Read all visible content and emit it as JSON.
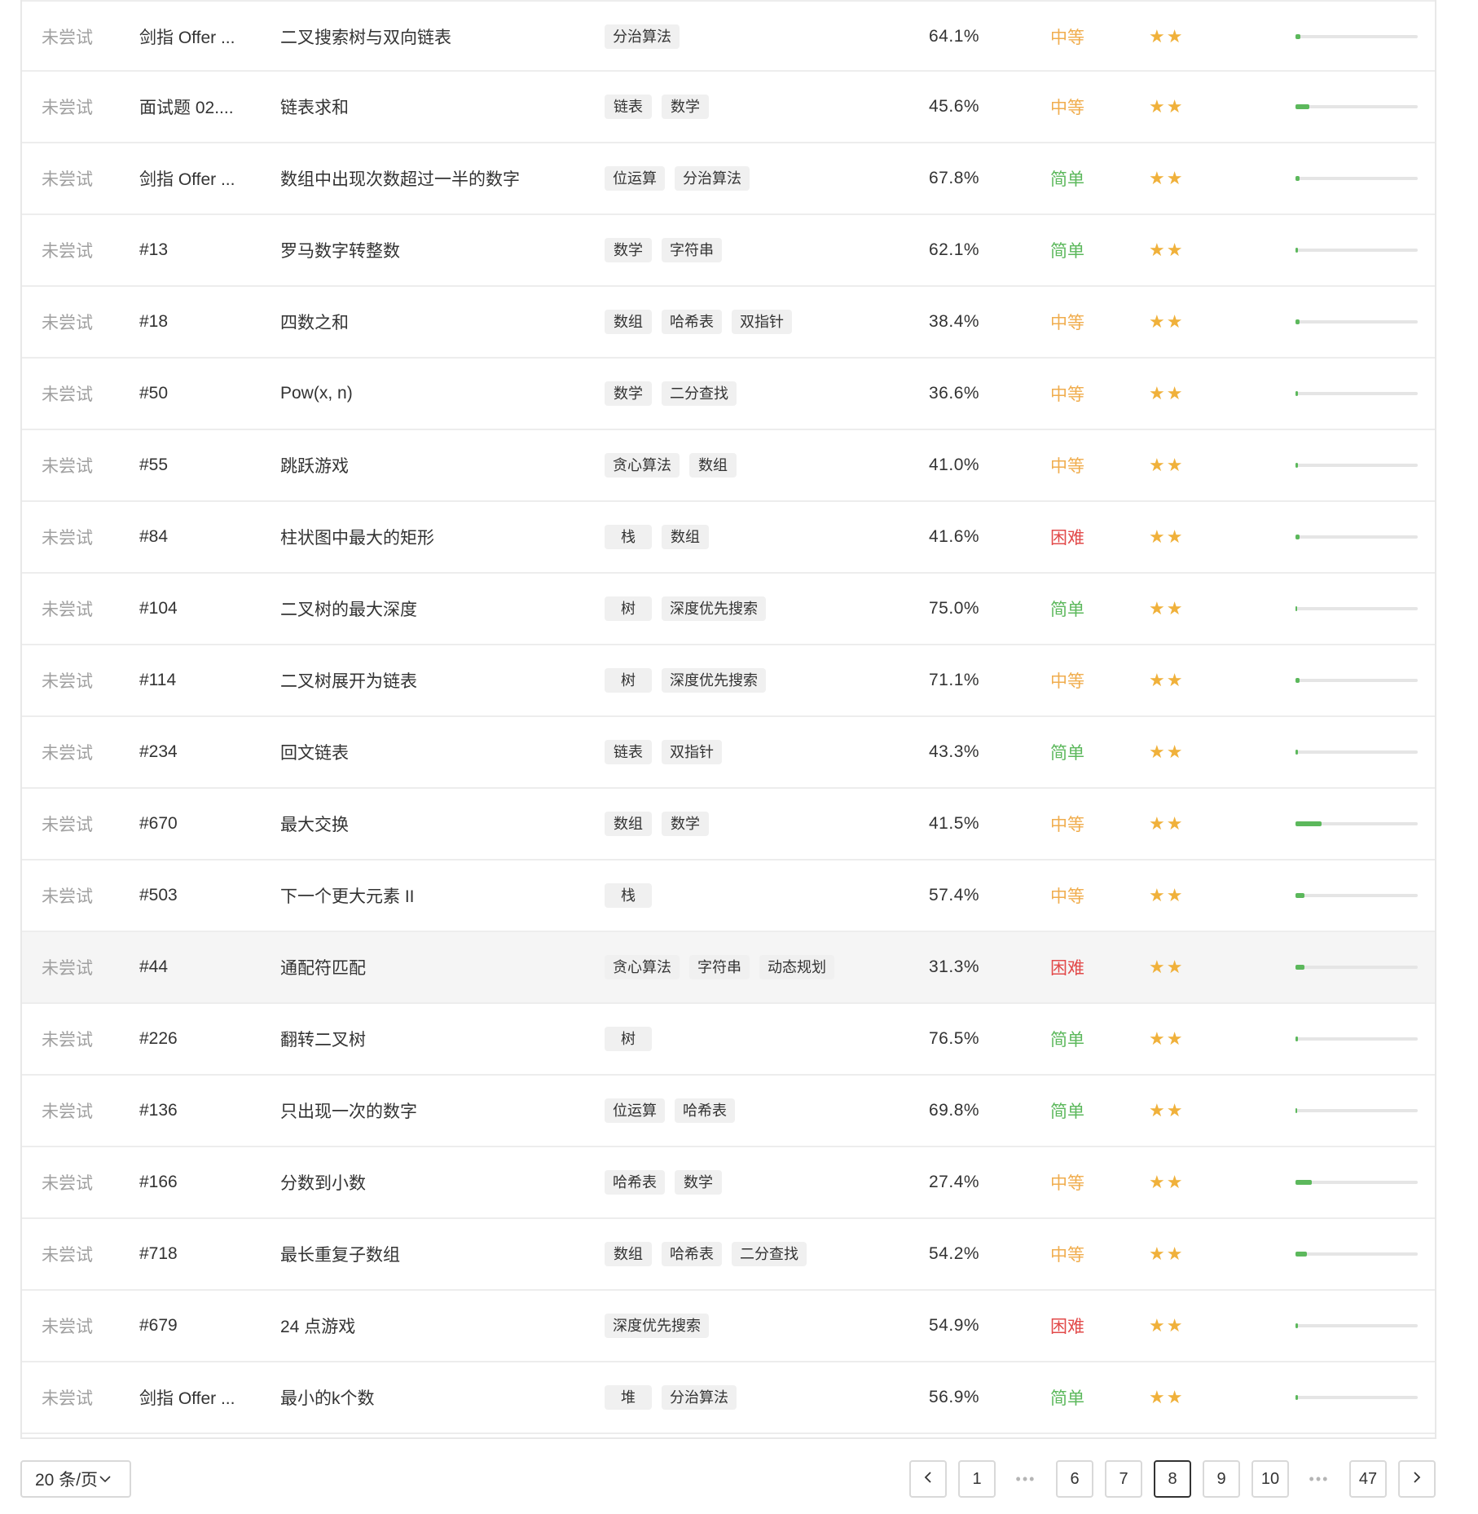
{
  "colors": {
    "easy": "#5cb85c",
    "medium": "#f0ad4e",
    "hard": "#e24a4a",
    "star": "#f0b13b"
  },
  "rows": [
    {
      "status": "未尝试",
      "id": "剑指 Offer ...",
      "title": "二叉搜索树与双向链表",
      "tags": [
        "分治算法"
      ],
      "rate": "64.1%",
      "difficulty": "中等",
      "level": "medium",
      "stars": "★★",
      "freq": 0.04
    },
    {
      "status": "未尝试",
      "id": "面试题 02....",
      "title": "链表求和",
      "tags": [
        "链表",
        "数学"
      ],
      "rate": "45.6%",
      "difficulty": "中等",
      "level": "medium",
      "stars": "★★",
      "freq": 0.11
    },
    {
      "status": "未尝试",
      "id": "剑指 Offer ...",
      "title": "数组中出现次数超过一半的数字",
      "tags": [
        "位运算",
        "分治算法"
      ],
      "rate": "67.8%",
      "difficulty": "简单",
      "level": "easy",
      "stars": "★★",
      "freq": 0.03
    },
    {
      "status": "未尝试",
      "id": "#13",
      "title": "罗马数字转整数",
      "tags": [
        "数学",
        "字符串"
      ],
      "rate": "62.1%",
      "difficulty": "简单",
      "level": "easy",
      "stars": "★★",
      "freq": 0.02
    },
    {
      "status": "未尝试",
      "id": "#18",
      "title": "四数之和",
      "tags": [
        "数组",
        "哈希表",
        "双指针"
      ],
      "rate": "38.4%",
      "difficulty": "中等",
      "level": "medium",
      "stars": "★★",
      "freq": 0.03
    },
    {
      "status": "未尝试",
      "id": "#50",
      "title": "Pow(x, n)",
      "tags": [
        "数学",
        "二分查找"
      ],
      "rate": "36.6%",
      "difficulty": "中等",
      "level": "medium",
      "stars": "★★",
      "freq": 0.02
    },
    {
      "status": "未尝试",
      "id": "#55",
      "title": "跳跃游戏",
      "tags": [
        "贪心算法",
        "数组"
      ],
      "rate": "41.0%",
      "difficulty": "中等",
      "level": "medium",
      "stars": "★★",
      "freq": 0.02
    },
    {
      "status": "未尝试",
      "id": "#84",
      "title": "柱状图中最大的矩形",
      "tags": [
        "栈",
        "数组"
      ],
      "rate": "41.6%",
      "difficulty": "困难",
      "level": "hard",
      "stars": "★★",
      "freq": 0.03
    },
    {
      "status": "未尝试",
      "id": "#104",
      "title": "二叉树的最大深度",
      "tags": [
        "树",
        "深度优先搜索"
      ],
      "rate": "75.0%",
      "difficulty": "简单",
      "level": "easy",
      "stars": "★★",
      "freq": 0.01
    },
    {
      "status": "未尝试",
      "id": "#114",
      "title": "二叉树展开为链表",
      "tags": [
        "树",
        "深度优先搜索"
      ],
      "rate": "71.1%",
      "difficulty": "中等",
      "level": "medium",
      "stars": "★★",
      "freq": 0.03
    },
    {
      "status": "未尝试",
      "id": "#234",
      "title": "回文链表",
      "tags": [
        "链表",
        "双指针"
      ],
      "rate": "43.3%",
      "difficulty": "简单",
      "level": "easy",
      "stars": "★★",
      "freq": 0.02
    },
    {
      "status": "未尝试",
      "id": "#670",
      "title": "最大交换",
      "tags": [
        "数组",
        "数学"
      ],
      "rate": "41.5%",
      "difficulty": "中等",
      "level": "medium",
      "stars": "★★",
      "freq": 0.21
    },
    {
      "status": "未尝试",
      "id": "#503",
      "title": "下一个更大元素 II",
      "tags": [
        "栈"
      ],
      "rate": "57.4%",
      "difficulty": "中等",
      "level": "medium",
      "stars": "★★",
      "freq": 0.07
    },
    {
      "status": "未尝试",
      "id": "#44",
      "title": "通配符匹配",
      "tags": [
        "贪心算法",
        "字符串",
        "动态规划"
      ],
      "rate": "31.3%",
      "difficulty": "困难",
      "level": "hard",
      "stars": "★★",
      "freq": 0.07
    },
    {
      "status": "未尝试",
      "id": "#226",
      "title": "翻转二叉树",
      "tags": [
        "树"
      ],
      "rate": "76.5%",
      "difficulty": "简单",
      "level": "easy",
      "stars": "★★",
      "freq": 0.02
    },
    {
      "status": "未尝试",
      "id": "#136",
      "title": "只出现一次的数字",
      "tags": [
        "位运算",
        "哈希表"
      ],
      "rate": "69.8%",
      "difficulty": "简单",
      "level": "easy",
      "stars": "★★",
      "freq": 0.01
    },
    {
      "status": "未尝试",
      "id": "#166",
      "title": "分数到小数",
      "tags": [
        "哈希表",
        "数学"
      ],
      "rate": "27.4%",
      "difficulty": "中等",
      "level": "medium",
      "stars": "★★",
      "freq": 0.13
    },
    {
      "status": "未尝试",
      "id": "#718",
      "title": "最长重复子数组",
      "tags": [
        "数组",
        "哈希表",
        "二分查找"
      ],
      "rate": "54.2%",
      "difficulty": "中等",
      "level": "medium",
      "stars": "★★",
      "freq": 0.09
    },
    {
      "status": "未尝试",
      "id": "#679",
      "title": "24 点游戏",
      "tags": [
        "深度优先搜索"
      ],
      "rate": "54.9%",
      "difficulty": "困难",
      "level": "hard",
      "stars": "★★",
      "freq": 0.02
    },
    {
      "status": "未尝试",
      "id": "剑指 Offer ...",
      "title": "最小的k个数",
      "tags": [
        "堆",
        "分治算法"
      ],
      "rate": "56.9%",
      "difficulty": "简单",
      "level": "easy",
      "stars": "★★",
      "freq": 0.02
    }
  ],
  "hover_row": 13,
  "pagination": {
    "page_size_label": "20 条/页",
    "page_size_icon": "chevron-down-icon",
    "prev_icon": "chevron-left-icon",
    "next_icon": "chevron-right-icon",
    "prev": "<",
    "next": ">",
    "ellipsis": "•••",
    "pages": [
      "1",
      "6",
      "7",
      "8",
      "9",
      "10",
      "47"
    ],
    "current": "8"
  }
}
